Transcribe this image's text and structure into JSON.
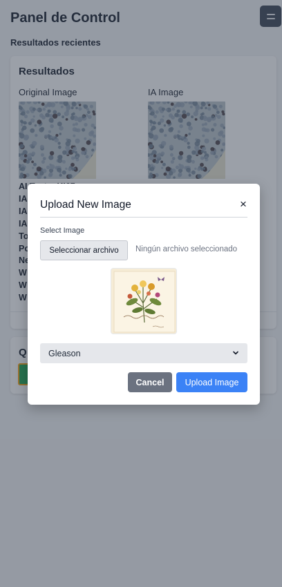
{
  "app": {
    "title": "Panel de Control"
  },
  "recent": {
    "heading": "Resultados recientes"
  },
  "results_card": {
    "title": "Resultados",
    "original_label": "Original Image",
    "ia_label": "IA Image",
    "lines": [
      "AI Tests: KI67",
      "IA",
      "IA",
      "IA",
      "To",
      "Po",
      "Ne",
      "W",
      "W",
      "W"
    ]
  },
  "second_card": {
    "title": "Q"
  },
  "modal": {
    "title": "Upload New Image",
    "close_symbol": "×",
    "select_label": "Select Image",
    "file_button": "Seleccionar archivo",
    "file_status": "Ningún archivo seleccionado",
    "select_value": "Gleason",
    "cancel_label": "Cancel",
    "upload_label": "Upload Image"
  },
  "colors": {
    "primary": "#3b82f6",
    "secondary": "#6b7280",
    "menu_button": "#374151",
    "overlay": "rgba(55,65,81,0.5)"
  },
  "icons": {
    "menu": "hamburger-icon",
    "close": "close-icon",
    "dropdown": "chevron-down-icon"
  }
}
